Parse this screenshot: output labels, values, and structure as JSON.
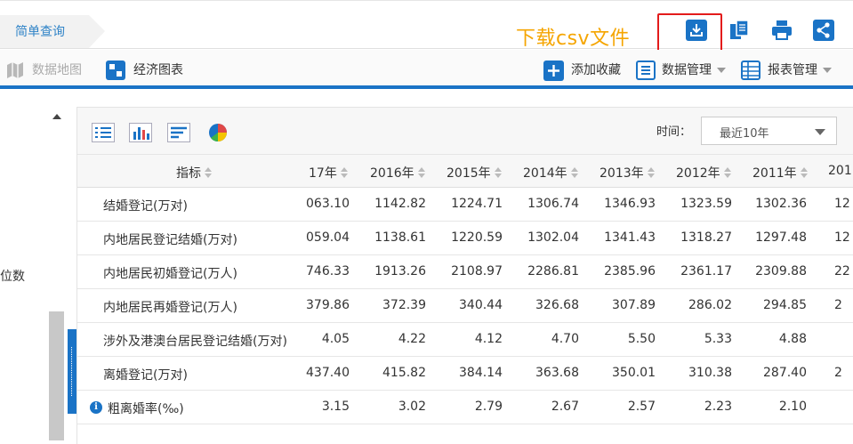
{
  "topbar": {
    "tab_label": "简单查询",
    "annotation": "下载csv文件"
  },
  "toolbar": {
    "map_label": "数据地图",
    "chart_label": "经济图表",
    "fav_label": "添加收藏",
    "data_mgmt_label": "数据管理",
    "report_mgmt_label": "报表管理"
  },
  "sidebar": {
    "partial_label": "位数"
  },
  "filter": {
    "time_label": "时间：",
    "time_value": "最近10年"
  },
  "table": {
    "indicator_header": "指标",
    "year_headers": [
      "17年",
      "2016年",
      "2015年",
      "2014年",
      "2013年",
      "2012年",
      "2011年",
      "201"
    ],
    "rows": [
      {
        "name": "结婚登记(万对)",
        "values": [
          "063.10",
          "1142.82",
          "1224.71",
          "1306.74",
          "1346.93",
          "1323.59",
          "1302.36",
          "12"
        ]
      },
      {
        "name": "内地居民登记结婚(万对)",
        "values": [
          "059.04",
          "1138.61",
          "1220.59",
          "1302.04",
          "1341.43",
          "1318.27",
          "1297.48",
          "12"
        ]
      },
      {
        "name": "内地居民初婚登记(万人)",
        "values": [
          "746.33",
          "1913.26",
          "2108.97",
          "2286.81",
          "2385.96",
          "2361.17",
          "2309.88",
          "22"
        ]
      },
      {
        "name": "内地居民再婚登记(万人)",
        "values": [
          "379.86",
          "372.39",
          "340.44",
          "326.68",
          "307.89",
          "286.02",
          "294.85",
          "2"
        ]
      },
      {
        "name": "涉外及港澳台居民登记结婚(万对)",
        "values": [
          "4.05",
          "4.22",
          "4.12",
          "4.70",
          "5.50",
          "5.33",
          "4.88",
          ""
        ]
      },
      {
        "name": "离婚登记(万对)",
        "values": [
          "437.40",
          "415.82",
          "384.14",
          "363.68",
          "350.01",
          "310.38",
          "287.40",
          "2"
        ]
      },
      {
        "name": "粗离婚率(‰)",
        "values": [
          "3.15",
          "3.02",
          "2.79",
          "2.67",
          "2.57",
          "2.23",
          "2.10",
          ""
        ]
      }
    ]
  },
  "colors": {
    "accent": "#1a73c6",
    "annotation": "#f5a500",
    "highlight_box": "#e31b1b"
  },
  "icons": {
    "download": "download-icon",
    "copy": "copy-icon",
    "print": "print-icon",
    "share": "share-icon",
    "map": "map-icon",
    "chart": "chart-icon",
    "add": "plus-icon",
    "data_mgmt": "list-icon",
    "report": "table-icon",
    "info": "info-icon"
  }
}
